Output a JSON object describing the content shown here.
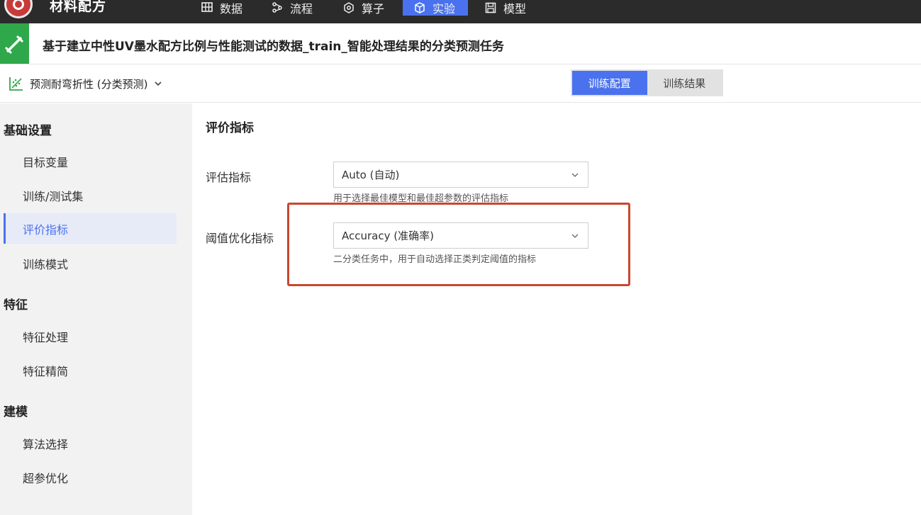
{
  "app": {
    "title": "材料配方"
  },
  "nav": [
    {
      "label": "数据",
      "icon": "grid-icon"
    },
    {
      "label": "流程",
      "icon": "flow-icon"
    },
    {
      "label": "算子",
      "icon": "hexagon-gear-icon"
    },
    {
      "label": "实验",
      "icon": "cube-icon",
      "active": true
    },
    {
      "label": "模型",
      "icon": "save-icon"
    }
  ],
  "task": {
    "title": "基于建立中性UV墨水配方比例与性能测试的数据_train_智能处理结果的分类预测任务"
  },
  "subbar": {
    "target": "预测耐弯折性 (分类预测)",
    "tabs": [
      {
        "label": "训练配置",
        "active": true
      },
      {
        "label": "训练结果",
        "active": false
      }
    ]
  },
  "sidebar": {
    "sections": [
      {
        "title": "基础设置",
        "items": [
          "目标变量",
          "训练/测试集",
          "评价指标",
          "训练模式"
        ]
      },
      {
        "title": "特征",
        "items": [
          "特征处理",
          "特征精简"
        ]
      },
      {
        "title": "建模",
        "items": [
          "算法选择",
          "超参优化"
        ]
      }
    ],
    "active_item": "评价指标"
  },
  "main": {
    "title": "评价指标",
    "fields": [
      {
        "label": "评估指标",
        "value": "Auto (自动)",
        "hint": "用于选择最佳模型和最佳超参数的评估指标"
      },
      {
        "label": "阈值优化指标",
        "value": "Accuracy (准确率)",
        "hint": "二分类任务中，用于自动选择正类判定阈值的指标"
      }
    ]
  },
  "colors": {
    "accent": "#4a72ee",
    "topbar": "#2b2b2b",
    "task_icon": "#2ea84a",
    "highlight": "#c9472f"
  }
}
